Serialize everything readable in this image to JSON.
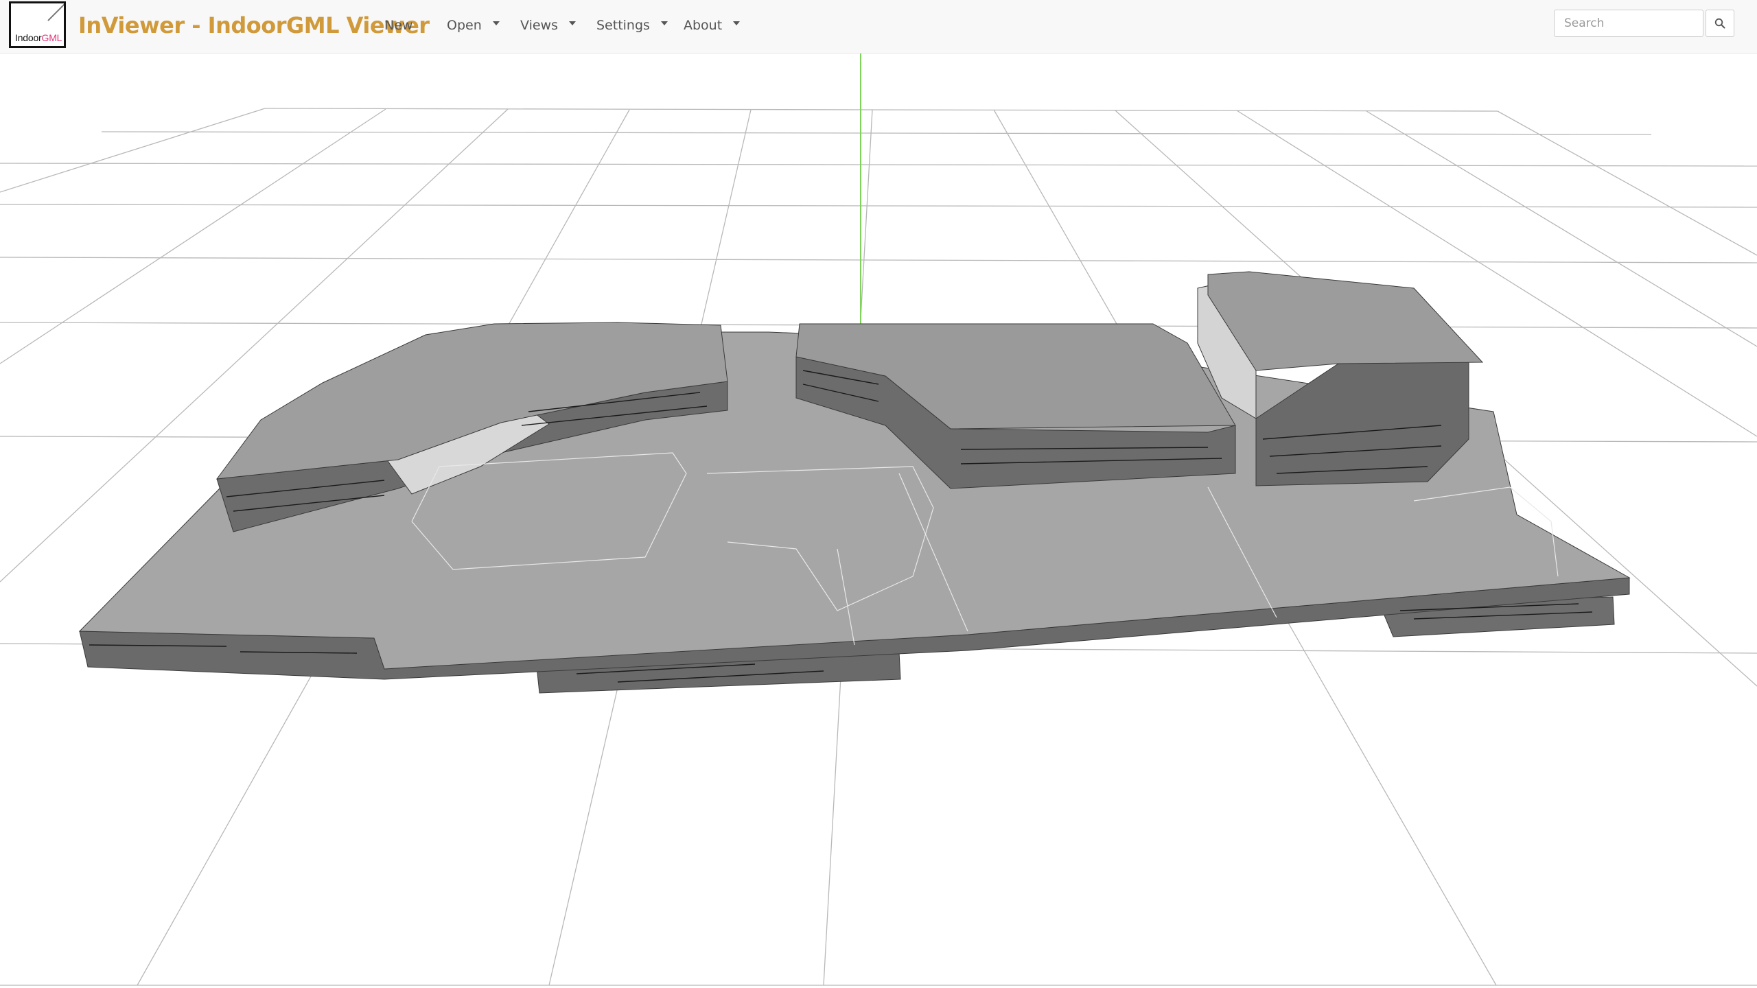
{
  "app": {
    "logo": {
      "text_main": "Indoor",
      "text_accent": "GML"
    },
    "title": "InViewer - IndoorGML Viewer"
  },
  "navbar": {
    "items": [
      {
        "label": "New",
        "has_dropdown": false
      },
      {
        "label": "Open",
        "has_dropdown": true
      },
      {
        "label": "Views",
        "has_dropdown": true
      },
      {
        "label": "Settings",
        "has_dropdown": true
      },
      {
        "label": "About",
        "has_dropdown": true
      }
    ],
    "search": {
      "placeholder": "Search",
      "value": "",
      "icon": "search-icon"
    }
  },
  "colors": {
    "brand": "#d09a3a",
    "logo_accent": "#e0337a",
    "navbar_bg": "#f8f8f8",
    "grid": "#b8b8b8",
    "axis_y": "#7fd35a",
    "axis_z": "#4a7bd8",
    "model_top": "#a6a6a6",
    "model_side": "#6e6e6e",
    "model_wall_light": "#d8d8d8"
  }
}
